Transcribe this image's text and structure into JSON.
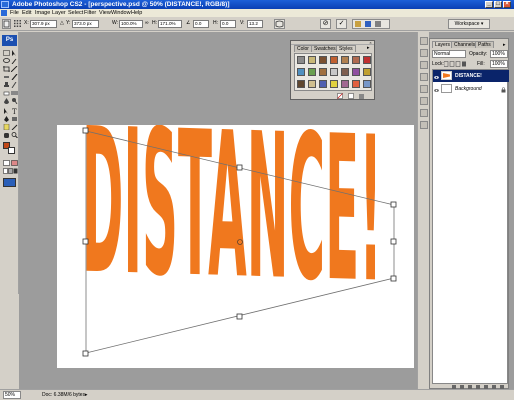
{
  "window": {
    "title": "Adobe Photoshop CS2 - [perspective.psd @ 50% (DISTANCE!, RGB/8)]",
    "minimize_label": "_",
    "restore_label": "□",
    "close_label": "×"
  },
  "menu": [
    "File",
    "Edit",
    "Image",
    "Layer",
    "Select",
    "Filter",
    "View",
    "Window",
    "Help"
  ],
  "options_bar": {
    "x_label": "X:",
    "x_value": "307.9 px",
    "y_label": "Y:",
    "y_value": "373.0 px",
    "w_label": "W:",
    "w_value": "100.0%",
    "h_label": "H:",
    "h_value": "171.0%",
    "angle_label": "∠",
    "angle_value": "0.0",
    "h_skew_label": "H:",
    "h_skew_value": "0.0",
    "v_skew_label": "V:",
    "v_skew_value": "13.2",
    "cancel_glyph": "⊘",
    "commit_glyph": "✓",
    "workspace_label": "Workspace ▾"
  },
  "canvas": {
    "text": "DISTANCE!",
    "text_color": "#f0781e",
    "bg_color": "#ffffff",
    "workspace_color": "#9c9c9c"
  },
  "styles_panel": {
    "tabs": [
      "Color",
      "Swatches",
      "Styles"
    ],
    "swatch_colors": [
      "#8a8a8a",
      "#c8b878",
      "#7a5030",
      "#c06030",
      "#b08050",
      "#b06a50",
      "#c03030",
      "#5090c0",
      "#6aa050",
      "#a07040",
      "#c8c8c8",
      "#806050",
      "#9050a0",
      "#c0a030",
      "#604830",
      "#d0c090",
      "#5060b0",
      "#e0d040",
      "#a06890",
      "#e06040",
      "#7898c8"
    ]
  },
  "layers_panel": {
    "tabs": [
      "Layers",
      "Channels",
      "Paths"
    ],
    "blend_mode": "Normal",
    "opacity_label": "Opacity:",
    "opacity_value": "100%",
    "lock_label": "Lock:",
    "fill_label": "Fill:",
    "fill_value": "100%",
    "layers": [
      {
        "name": "DISTANCE!",
        "selected": true
      },
      {
        "name": "Background",
        "selected": false
      }
    ]
  },
  "status_bar": {
    "zoom": "50%",
    "doc_info": "Doc: 6.38M/6 bytes"
  },
  "colors": {
    "title_bar": "#0a3fb4",
    "layer_selected": "#0a246a",
    "chrome": "#d4d0c8"
  }
}
